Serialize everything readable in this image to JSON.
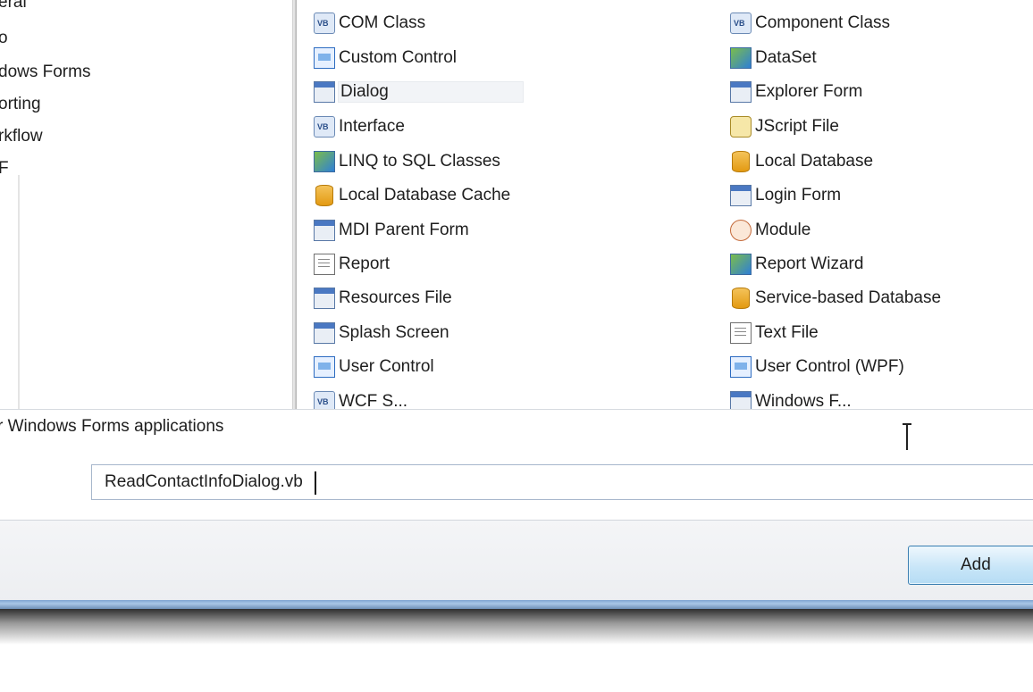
{
  "categories": [
    "eral",
    "o",
    "dows Forms",
    "orting",
    "rkflow",
    "F"
  ],
  "templates": {
    "left": [
      {
        "label": "COM Class",
        "icon": "vb-class-icon"
      },
      {
        "label": "Custom Control",
        "icon": "custom-control-icon"
      },
      {
        "label": "Dialog",
        "icon": "dialog-icon",
        "selected": true
      },
      {
        "label": "Interface",
        "icon": "vb-interface-icon"
      },
      {
        "label": "LINQ to SQL Classes",
        "icon": "linq-icon"
      },
      {
        "label": "Local Database Cache",
        "icon": "database-cache-icon"
      },
      {
        "label": "MDI Parent Form",
        "icon": "mdi-form-icon"
      },
      {
        "label": "Report",
        "icon": "report-icon"
      },
      {
        "label": "Resources File",
        "icon": "resources-icon"
      },
      {
        "label": "Splash Screen",
        "icon": "splash-screen-icon"
      },
      {
        "label": "User Control",
        "icon": "user-control-icon"
      },
      {
        "label": "WCF S...",
        "icon": "wcf-service-icon"
      }
    ],
    "right": [
      {
        "label": "Component Class",
        "icon": "component-class-icon"
      },
      {
        "label": "DataSet",
        "icon": "dataset-icon"
      },
      {
        "label": "Explorer Form",
        "icon": "explorer-form-icon"
      },
      {
        "label": "JScript File",
        "icon": "jscript-icon"
      },
      {
        "label": "Local Database",
        "icon": "database-icon"
      },
      {
        "label": "Login Form",
        "icon": "login-form-icon"
      },
      {
        "label": "Module",
        "icon": "module-icon"
      },
      {
        "label": "Report Wizard",
        "icon": "report-wizard-icon"
      },
      {
        "label": "Service-based Database",
        "icon": "database-icon"
      },
      {
        "label": "Text File",
        "icon": "text-file-icon"
      },
      {
        "label": "User Control (WPF)",
        "icon": "wpf-user-control-icon"
      },
      {
        "label": "Windows F...",
        "icon": "windows-form-icon"
      }
    ]
  },
  "description": "r Windows Forms applications",
  "name_field": {
    "value": "ReadContactInfoDialog.vb"
  },
  "add_button": {
    "label": "Add"
  },
  "colors": {
    "accent": "#3c7fb1",
    "frame": "#7fa4d0"
  }
}
